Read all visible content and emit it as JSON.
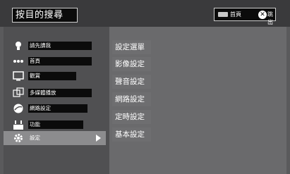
{
  "header": {
    "title": "按目的搜尋",
    "home_label": "首頁",
    "exit_label": "跳出"
  },
  "sidebar": {
    "items": [
      {
        "label": "請先讀我",
        "icon": "lightbulb-icon"
      },
      {
        "label": "首頁",
        "icon": "home-dots-icon"
      },
      {
        "label": "觀賞",
        "icon": "tv-icon"
      },
      {
        "label": "多媒體播放",
        "icon": "media-icon"
      },
      {
        "label": "網路設定",
        "icon": "globe-icon"
      },
      {
        "label": "功能",
        "icon": "functions-icon"
      },
      {
        "label": "設定",
        "icon": "gear-icon",
        "selected": true
      }
    ]
  },
  "submenu": {
    "items": [
      "設定選單",
      "影像設定",
      "聲音設定",
      "網路設定",
      "定時設定",
      "基本設定"
    ]
  },
  "colors": {
    "background": "#5a5a5c",
    "title_bar": "#3a3a3c",
    "label_black": "#0b0b0b",
    "selected": "#8c8c8e"
  }
}
